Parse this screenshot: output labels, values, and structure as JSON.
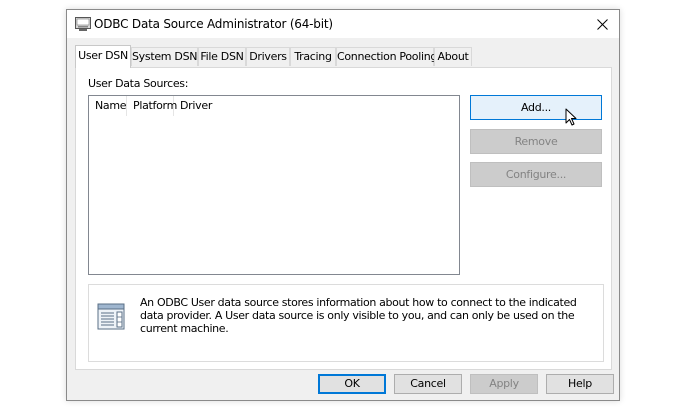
{
  "window": {
    "title": "ODBC Data Source Administrator (64-bit)",
    "icon": "odbc-admin-icon",
    "close_icon": "close-icon"
  },
  "tabs": [
    {
      "label": "User DSN",
      "active": true
    },
    {
      "label": "System DSN",
      "active": false
    },
    {
      "label": "File DSN",
      "active": false
    },
    {
      "label": "Drivers",
      "active": false
    },
    {
      "label": "Tracing",
      "active": false
    },
    {
      "label": "Connection Pooling",
      "active": false
    },
    {
      "label": "About",
      "active": false
    }
  ],
  "user_dsn": {
    "section_label": "User Data Sources:",
    "columns": [
      "Name",
      "Platform",
      "Driver"
    ],
    "rows": [],
    "buttons": {
      "add": "Add...",
      "remove": "Remove",
      "configure": "Configure..."
    },
    "info_icon": "data-source-icon",
    "info_text": "An ODBC User data source stores information about how to connect to the indicated data provider.  A User data source is only visible to you, and can only be used on the current machine."
  },
  "footer": {
    "ok": "OK",
    "cancel": "Cancel",
    "apply": "Apply",
    "help": "Help"
  },
  "colors": {
    "accent": "#0078d7",
    "window_bg": "#f0f0f0",
    "disabled_text": "#838383"
  }
}
